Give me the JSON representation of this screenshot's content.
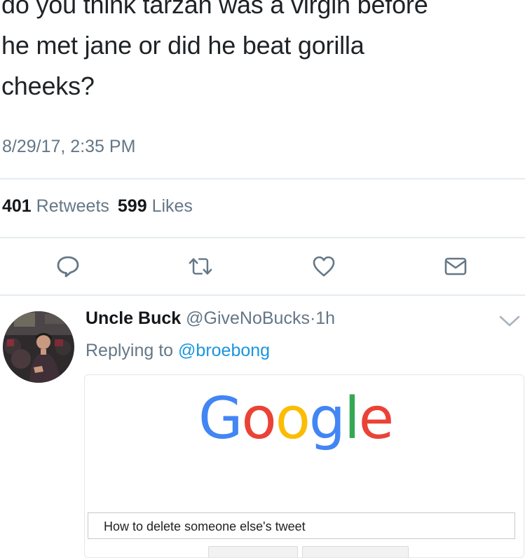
{
  "tweet": {
    "text_line1": "do you think tarzan was a virgin before",
    "text_line2": "he met jane or did he beat gorilla",
    "text_line3": "cheeks?",
    "timestamp": "8/29/17, 2:35 PM",
    "retweet_count": "401",
    "retweet_label": "Retweets",
    "like_count": "599",
    "like_label": "Likes"
  },
  "actions": [
    {
      "name": "reply-icon"
    },
    {
      "name": "retweet-icon"
    },
    {
      "name": "like-icon"
    },
    {
      "name": "message-icon"
    }
  ],
  "reply": {
    "display_name": "Uncle Buck",
    "handle": "@GiveNoBucks",
    "separator": "·",
    "time": "1h",
    "replying_prefix": "Replying to",
    "replying_to": "@broebong",
    "image": {
      "logo_letters": [
        "G",
        "o",
        "o",
        "g",
        "l",
        "e"
      ],
      "logo_colors": [
        "#4285F4",
        "#EA4335",
        "#FBBC05",
        "#4285F4",
        "#34A853",
        "#EA4335"
      ],
      "search_query": "How to delete someone else's tweet"
    }
  },
  "colors": {
    "text": "#14171a",
    "secondary": "#657786",
    "link": "#1b95e0",
    "divider": "#e6ecf0"
  }
}
